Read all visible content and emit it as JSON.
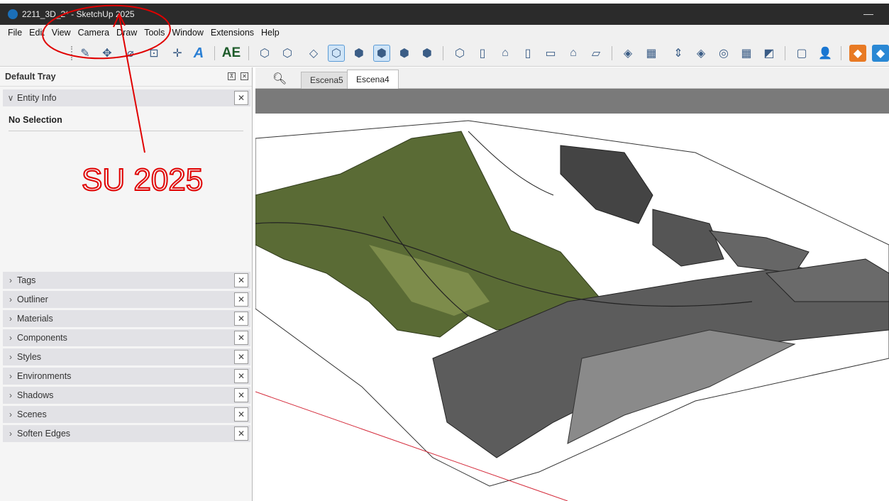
{
  "window": {
    "title": "2211_3D_2* - SketchUp 2025",
    "minimize": "—"
  },
  "menu": [
    "File",
    "Edit",
    "View",
    "Camera",
    "Draw",
    "Tools",
    "Window",
    "Extensions",
    "Help"
  ],
  "toolbar": {
    "ae_label": "AE",
    "icons": [
      "sandbox-draw-icon",
      "interact-icon",
      "eraser-icon",
      "text-label-icon",
      "axes-icon",
      "3d-text-icon"
    ]
  },
  "tray": {
    "title": "Default Tray",
    "entity_info": {
      "label": "Entity Info",
      "status": "No Selection"
    },
    "panels": [
      "Tags",
      "Outliner",
      "Materials",
      "Components",
      "Styles",
      "Environments",
      "Shadows",
      "Scenes",
      "Soften Edges"
    ]
  },
  "scenes": {
    "tabs": [
      "Escena5",
      "Escena4"
    ],
    "active": "Escena4"
  },
  "annotation": {
    "text": "SU 2025",
    "color": "#e00000"
  }
}
